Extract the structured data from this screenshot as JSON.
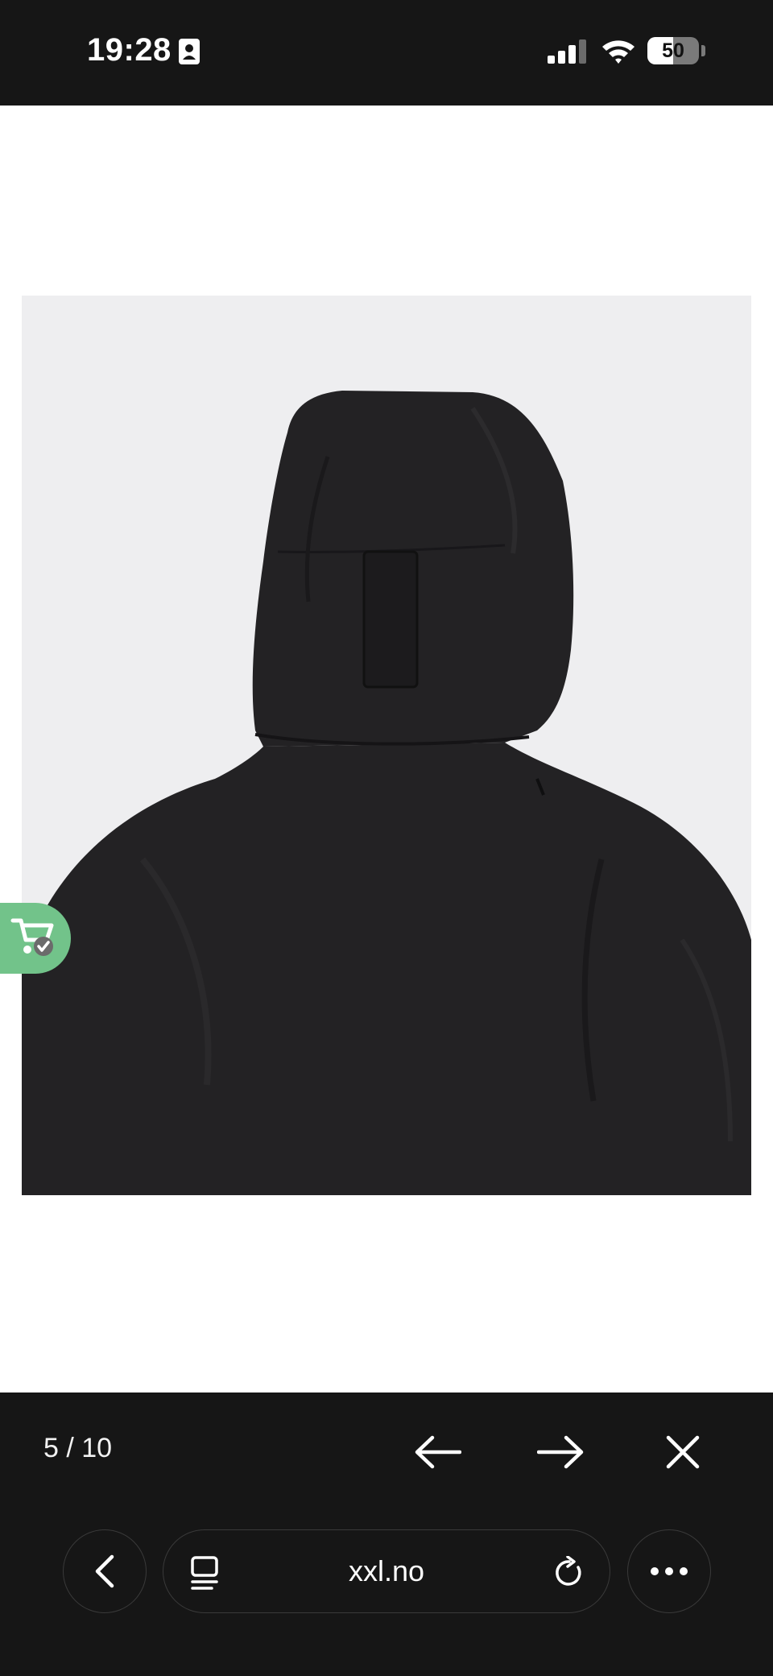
{
  "status_bar": {
    "time": "19:28",
    "battery_text": "50",
    "battery_level": 0.5,
    "icons": [
      "contact-card-icon",
      "cellular-signal-icon",
      "wifi-icon",
      "battery-icon"
    ]
  },
  "gallery": {
    "counter": "5 / 10",
    "buttons": [
      "arrow-left-icon",
      "arrow-right-icon",
      "close-icon"
    ]
  },
  "product_image": {
    "background_color": "#eeeef0",
    "jacket_color": "#232224"
  },
  "cart_badge": {
    "color": "#72c38a",
    "icon": "cart-check-icon"
  },
  "browser": {
    "url": "xxl.no",
    "icons": [
      "chevron-left-icon",
      "tabs-icon",
      "reload-icon",
      "more-icon"
    ]
  }
}
